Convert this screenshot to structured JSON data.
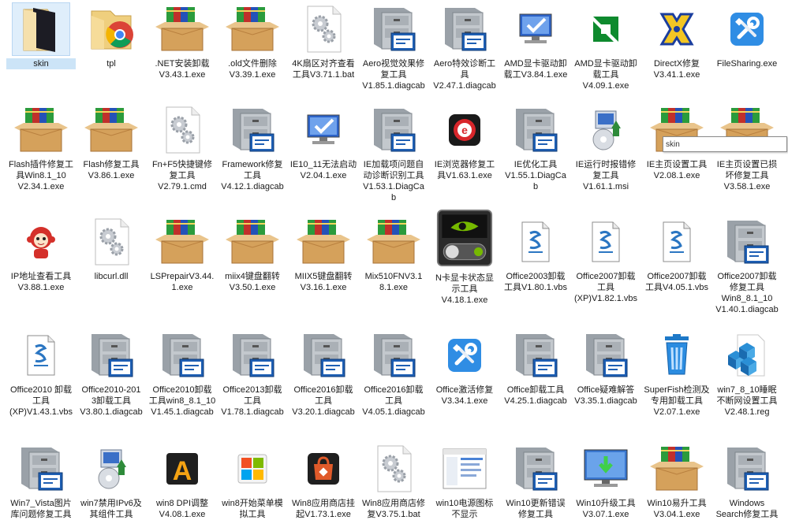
{
  "colors": {
    "selection": "#cce4f7",
    "folder": "#e8c36a",
    "box": "#d7a35f"
  },
  "items": [
    {
      "label": "skin",
      "icon": "folder-dark-icon",
      "selected": true
    },
    {
      "label": "tpl",
      "icon": "folder-chrome-icon"
    },
    {
      "label": ".NET安装卸载\nV3.43.1.exe",
      "icon": "books-box-icon"
    },
    {
      "label": ".old文件删除\nV3.39.1.exe",
      "icon": "books-box-icon"
    },
    {
      "label": "4K扇区对齐查看\n工具V3.71.1.bat",
      "icon": "gears-file-icon"
    },
    {
      "label": "Aero视觉效果修\n复工具\nV1.85.1.diagcab",
      "icon": "cabinet-icon"
    },
    {
      "label": "Aero特效诊断工\n具\nV2.47.1.diagcab",
      "icon": "cabinet-icon"
    },
    {
      "label": "AMD显卡驱动卸\n载工V3.84.1.exe",
      "icon": "monitor-check-icon"
    },
    {
      "label": "AMD显卡驱动卸\n载工具\nV4.09.1.exe",
      "icon": "amd-logo-icon"
    },
    {
      "label": "DirectX修复\nV3.41.1.exe",
      "icon": "directx-icon"
    },
    {
      "label": "FileSharing.exe",
      "icon": "tools-blue-icon"
    },
    {
      "label": "Flash插件修复工\n具Win8.1_10\nV2.34.1.exe",
      "icon": "books-box-icon"
    },
    {
      "label": "Flash修复工具\nV3.86.1.exe",
      "icon": "books-box-icon"
    },
    {
      "label": "Fn+F5快捷键修\n复工具\nV2.79.1.cmd",
      "icon": "gears-file-icon"
    },
    {
      "label": "Framework修复\n工具\nV4.12.1.diagcab",
      "icon": "cabinet-icon"
    },
    {
      "label": "IE10_11无法启动\nV2.04.1.exe",
      "icon": "monitor-check-icon"
    },
    {
      "label": "IE加载项问题自\n动诊断识别工具\nV1.53.1.DiagCa\nb",
      "icon": "cabinet-icon"
    },
    {
      "label": "IE浏览器修复工\n具V1.63.1.exe",
      "icon": "ie-red-icon"
    },
    {
      "label": "IE优化工具\nV1.55.1.DiagCa\nb",
      "icon": "cabinet-icon"
    },
    {
      "label": "IE运行时报错修\n复工具\nV1.61.1.msi",
      "icon": "installer-icon"
    },
    {
      "label": "IE主页设置工具\nV2.08.1.exe",
      "icon": "books-box-icon"
    },
    {
      "label": "IE主页设置已损\n坏修复工具\nV3.58.1.exe",
      "icon": "books-box-icon"
    },
    {
      "label": "IP地址查看工具\nV3.88.1.exe",
      "icon": "mascot-icon"
    },
    {
      "label": "libcurl.dll",
      "icon": "gears-file-icon"
    },
    {
      "label": "LSPrepairV3.44.\n1.exe",
      "icon": "books-box-icon"
    },
    {
      "label": "miix4键盘翻转\nV3.50.1.exe",
      "icon": "books-box-icon"
    },
    {
      "label": "MIIX5键盘翻转\nV3.16.1.exe",
      "icon": "books-box-icon"
    },
    {
      "label": "Mix510FNV3.1\n8.1.exe",
      "icon": "books-box-icon"
    },
    {
      "label": "N卡显卡状态显\n示工具\nV4.18.1.exe",
      "icon": "nvidia-icon"
    },
    {
      "label": "Office2003卸载\n工具V1.80.1.vbs",
      "icon": "script-icon"
    },
    {
      "label": "Office2007卸载\n工具\n(XP)V1.82.1.vbs",
      "icon": "script-icon"
    },
    {
      "label": "Office2007卸载\n工具V4.05.1.vbs",
      "icon": "script-icon"
    },
    {
      "label": "Office2007卸载\n修复工具\nWin8_8.1_10\nV1.40.1.diagcab",
      "icon": "cabinet-icon"
    },
    {
      "label": "Office2010 卸载\n工具\n(XP)V1.43.1.vbs",
      "icon": "script-icon"
    },
    {
      "label": "Office2010-201\n3卸载工具\nV3.80.1.diagcab",
      "icon": "cabinet-icon"
    },
    {
      "label": "Office2010卸载\n工具win8_8.1_10\nV1.45.1.diagcab",
      "icon": "cabinet-icon"
    },
    {
      "label": "Office2013卸载\n工具\nV1.78.1.diagcab",
      "icon": "cabinet-icon"
    },
    {
      "label": "Office2016卸载\n工具\nV3.20.1.diagcab",
      "icon": "cabinet-icon"
    },
    {
      "label": "Office2016卸载\n工具\nV4.05.1.diagcab",
      "icon": "cabinet-icon"
    },
    {
      "label": "Office激活修复\nV3.34.1.exe",
      "icon": "tools-blue-icon"
    },
    {
      "label": "Office卸载工具\nV4.25.1.diagcab",
      "icon": "cabinet-icon"
    },
    {
      "label": "Office疑难解答\nV3.35.1.diagcab",
      "icon": "cabinet-icon"
    },
    {
      "label": "SuperFish检测及\n专用卸载工具\nV2.07.1.exe",
      "icon": "recycle-bin-icon"
    },
    {
      "label": "win7_8_10睡眠\n不断网设置工具\nV2.48.1.reg",
      "icon": "registry-icon"
    },
    {
      "label": "Win7_Vista图片\n库问题修复工具",
      "icon": "cabinet-icon"
    },
    {
      "label": "win7禁用IPv6及\n其组件工具",
      "icon": "installer-icon"
    },
    {
      "label": "win8 DPI调整\nV4.08.1.exe",
      "icon": "letter-a-icon"
    },
    {
      "label": "win8开始菜单模\n拟工具",
      "icon": "win-start-icon"
    },
    {
      "label": "Win8应用商店挂\n起V1.73.1.exe",
      "icon": "store-bag-icon"
    },
    {
      "label": "Win8应用商店修\n复V3.75.1.bat",
      "icon": "gears-file-icon"
    },
    {
      "label": "win10电源图标\n不显示",
      "icon": "window-doc-icon"
    },
    {
      "label": "Win10更新错误\n修复工具",
      "icon": "cabinet-icon"
    },
    {
      "label": "Win10升级工具\nV3.07.1.exe",
      "icon": "monitor-arrow-icon"
    },
    {
      "label": "Win10易升工具\nV3.04.1.exe",
      "icon": "books-box-icon"
    },
    {
      "label": "Windows\nSearch修复工具",
      "icon": "cabinet-icon"
    }
  ],
  "tooltip": {
    "text": "skin"
  }
}
